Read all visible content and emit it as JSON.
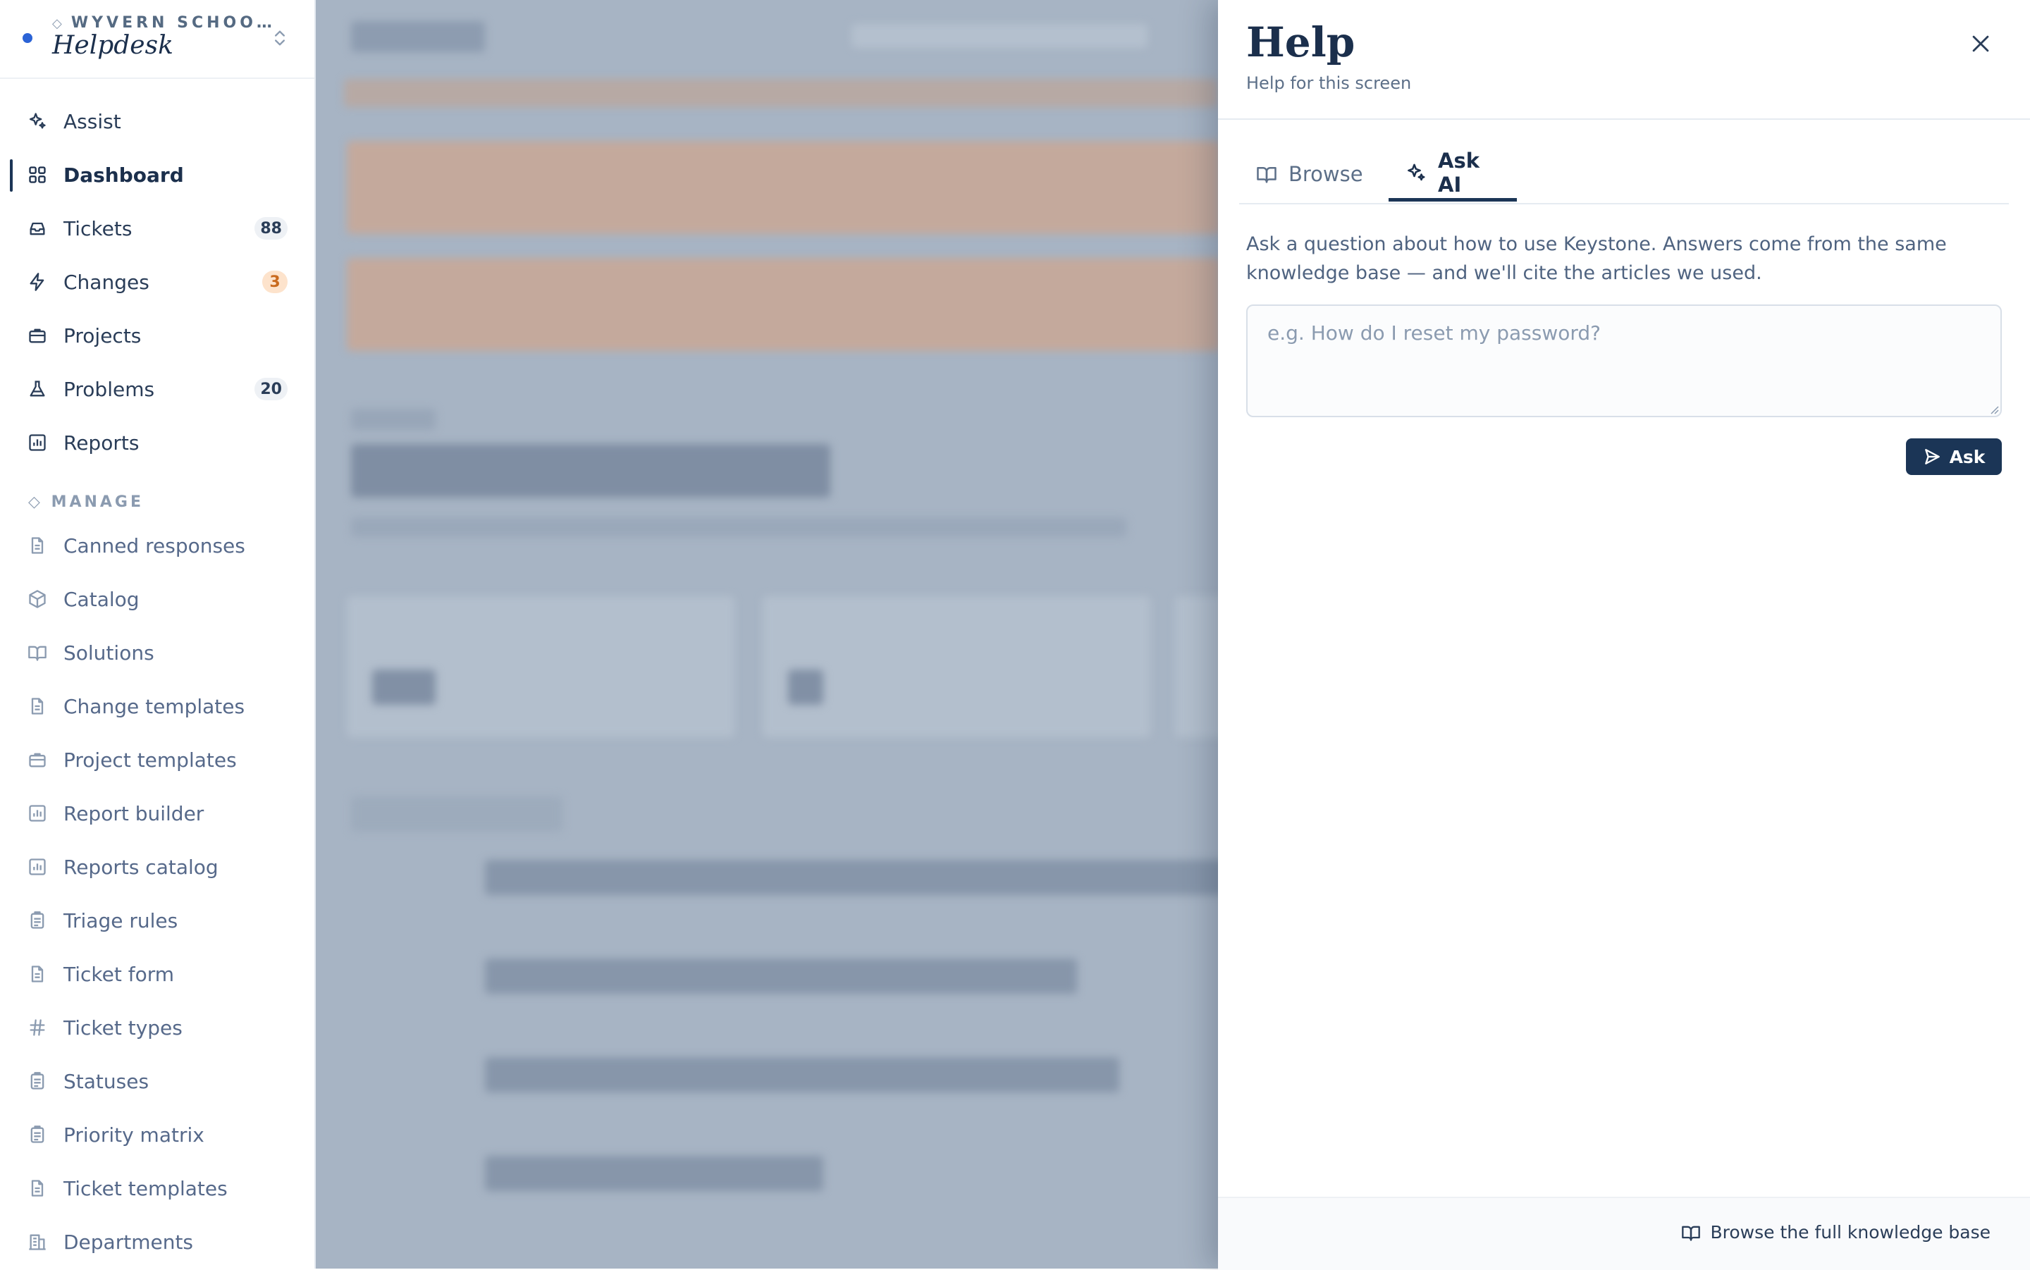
{
  "workspace": {
    "org": "WYVERN SCHOO…",
    "name": "Helpdesk"
  },
  "nav": {
    "items": [
      {
        "label": "Assist"
      },
      {
        "label": "Dashboard"
      },
      {
        "label": "Tickets",
        "badge": "88"
      },
      {
        "label": "Changes",
        "badge": "3"
      },
      {
        "label": "Projects"
      },
      {
        "label": "Problems",
        "badge": "20"
      },
      {
        "label": "Reports"
      }
    ],
    "active": "Dashboard"
  },
  "manage": {
    "title": "MANAGE",
    "items": [
      {
        "label": "Canned responses"
      },
      {
        "label": "Catalog"
      },
      {
        "label": "Solutions"
      },
      {
        "label": "Change templates"
      },
      {
        "label": "Project templates"
      },
      {
        "label": "Report builder"
      },
      {
        "label": "Reports catalog"
      },
      {
        "label": "Triage rules"
      },
      {
        "label": "Ticket form"
      },
      {
        "label": "Ticket types"
      },
      {
        "label": "Statuses"
      },
      {
        "label": "Priority matrix"
      },
      {
        "label": "Ticket templates"
      },
      {
        "label": "Departments"
      }
    ]
  },
  "help": {
    "title": "Help",
    "subtitle": "Help for this screen",
    "tabs": [
      {
        "label": "Browse"
      },
      {
        "label": "Ask AI"
      }
    ],
    "active_tab": "Ask AI",
    "intro": "Ask a question about how to use Keystone. Answers come from the same knowledge base — and we'll cite the articles we used.",
    "question": {
      "value": "",
      "placeholder": "e.g. How do I reset my password?"
    },
    "ask_label": "Ask",
    "footer_link": "Browse the full knowledge base"
  },
  "colors": {
    "accent": "#1b3556",
    "workspace_dot": "#2b63d6",
    "badge_orange_bg": "#fde3cc",
    "badge_orange_text": "#c96a1e",
    "overlay": "#a7b4c4"
  },
  "icons": {
    "close": "close-icon",
    "browse": "book-icon",
    "ask": "sparkles-icon",
    "send": "send-icon"
  }
}
